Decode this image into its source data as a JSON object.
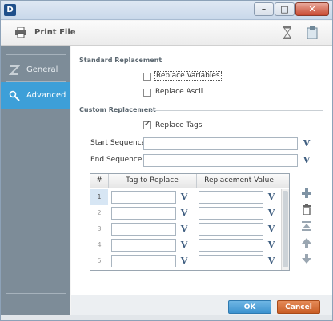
{
  "window": {
    "app_icon_letter": "D",
    "minimize_glyph": "–",
    "maximize_glyph": "□",
    "close_glyph": "✕"
  },
  "header": {
    "title": "Print File",
    "icons": [
      "printer-icon",
      "hourglass-icon",
      "clipboard-icon"
    ]
  },
  "sidebar": {
    "items": [
      {
        "label": "General",
        "icon": "general-icon",
        "active": false
      },
      {
        "label": "Advanced",
        "icon": "advanced-icon",
        "active": true
      }
    ]
  },
  "standard_replacement": {
    "title": "Standard Replacement",
    "replace_variables": {
      "label": "Replace Variables",
      "checked": false
    },
    "replace_ascii": {
      "label": "Replace Ascii",
      "checked": false
    }
  },
  "custom_replacement": {
    "title": "Custom Replacement",
    "replace_tags": {
      "label": "Replace Tags",
      "checked": true
    },
    "start_sequence": {
      "label": "Start Sequence",
      "value": ""
    },
    "end_sequence": {
      "label": "End Sequence",
      "value": ""
    },
    "v_button": "V"
  },
  "table": {
    "columns": [
      "#",
      "Tag to Replace",
      "Replacement Value"
    ],
    "rows": [
      {
        "num": "1",
        "tag": "",
        "value": ""
      },
      {
        "num": "2",
        "tag": "",
        "value": ""
      },
      {
        "num": "3",
        "tag": "",
        "value": ""
      },
      {
        "num": "4",
        "tag": "",
        "value": ""
      },
      {
        "num": "5",
        "tag": "",
        "value": ""
      }
    ],
    "selected_row": 1
  },
  "row_tools": [
    "add-icon",
    "delete-icon",
    "move-top-icon",
    "move-up-icon",
    "move-down-icon"
  ],
  "footer": {
    "ok_label": "OK",
    "cancel_label": "Cancel"
  },
  "colors": {
    "accent": "#3d9fd8",
    "sidebar": "#7d8c98",
    "ok": "#3d93cf",
    "cancel": "#c95d25"
  }
}
